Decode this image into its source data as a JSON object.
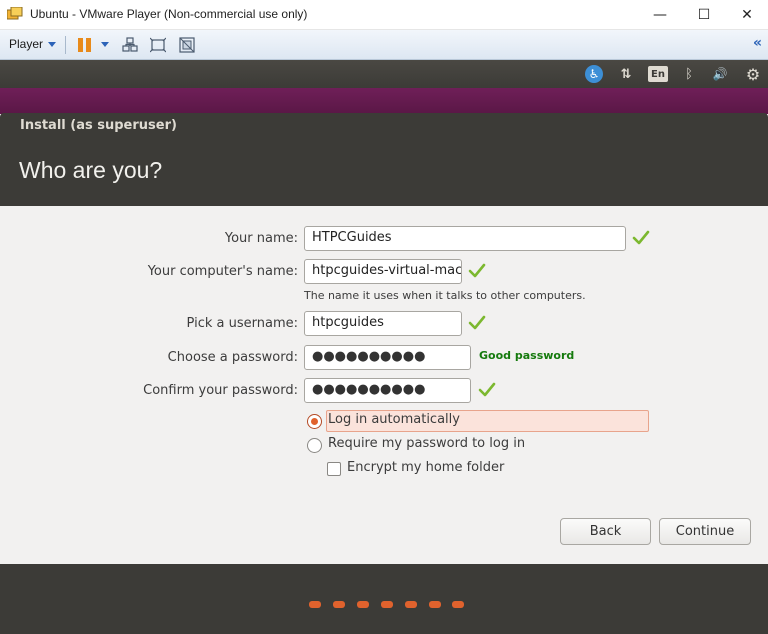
{
  "window": {
    "title": "Ubuntu - VMware Player (Non-commercial use only)",
    "minimize_glyph": "—",
    "maximize_glyph": "☐",
    "close_glyph": "✕"
  },
  "vmware_toolbar": {
    "player_menu": "Player",
    "icons": [
      "pause-icon",
      "send-ctrl-alt-del-icon",
      "fit-guest-icon",
      "unity-icon"
    ],
    "collapse_glyph": "«",
    "accent": "#e88a1a"
  },
  "ubuntu_panel": {
    "accessibility_glyph": "♿",
    "network_glyph": "⇅",
    "keyboard_layout": "En",
    "bluetooth_glyph": "ᛒ",
    "volume_glyph": "🔊",
    "settings_glyph": "⚙"
  },
  "installer": {
    "window_title": "Install (as superuser)",
    "page_title": "Who are you?",
    "fields": {
      "name_label": "Your name:",
      "name_value": "HTPCGuides",
      "computer_label": "Your computer's name:",
      "computer_value": "htpcguides-virtual-mac",
      "computer_hint": "The name it uses when it talks to other computers.",
      "username_label": "Pick a username:",
      "username_value": "htpcguides",
      "password_label": "Choose a password:",
      "password_value": "●●●●●●●●●●",
      "password_strength": "Good password",
      "confirm_label": "Confirm your password:",
      "confirm_value": "●●●●●●●●●●"
    },
    "login_options": {
      "auto_login": "Log in automatically",
      "require_password": "Require my password to log in",
      "encrypt_home": "Encrypt my home folder",
      "selected": "auto_login"
    },
    "buttons": {
      "back": "Back",
      "continue": "Continue"
    },
    "progress_dots": 7,
    "colors": {
      "accent": "#e0622d",
      "header_bg": "#3c3b37",
      "ok_green": "#7cb82f",
      "strength_green": "#157a0d"
    }
  }
}
